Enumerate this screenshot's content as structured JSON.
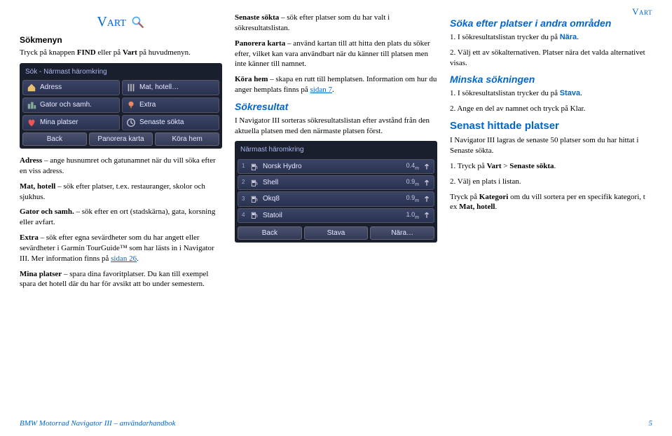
{
  "page_header": "Vart",
  "col1": {
    "heading": "Vart",
    "sokmenyn": "Sökmenyn",
    "intro1": "Tryck på knappen ",
    "intro_find": "FIND",
    "intro2": " eller på ",
    "intro_vart": "Vart",
    "intro3": " på huvudmenyn.",
    "shot1": {
      "title": "Sök - Närmast häromkring",
      "b_adress": "Adress",
      "b_mat": "Mat, hotell…",
      "b_gator": "Gator och samh.",
      "b_extra": "Extra",
      "b_mina": "Mina platser",
      "b_senaste": "Senaste sökta",
      "bb_back": "Back",
      "bb_pan": "Panorera karta",
      "bb_kora": "Köra hem"
    },
    "p_adress_b": "Adress",
    "p_adress": " – ange husnumret och gatunamnet när du vill söka efter en viss adress.",
    "p_mat_b": "Mat, hotell",
    "p_mat": " – sök efter platser, t.ex. restauranger, skolor och sjukhus.",
    "p_gator_b": "Gator och samh.",
    "p_gator": " – sök efter en ort (stadskärna), gata, korsning eller avfart.",
    "p_extra_b": "Extra",
    "p_extra1": " – sök efter egna sevärdheter som du har angett eller sevärdheter i Garmin TourGuide™ som har lästs in i Navigator III. Mer information finns på ",
    "p_extra_link": "sidan 26",
    "p_extra2": ".",
    "p_mina_b": "Mina platser",
    "p_mina": " – spara dina favoritplatser. Du kan till exempel spara det hotell där du har för avsikt att bo under semestern."
  },
  "col2": {
    "p_sen_b": "Senaste sökta",
    "p_sen": " – sök efter platser som du har valt i sökresultatslistan.",
    "p_pan_b": "Panorera karta",
    "p_pan": " – använd kartan till att hitta den plats du söker efter, vilket kan vara användbart när du känner till platsen men inte känner till namnet.",
    "p_kora_b": "Köra hem",
    "p_kora1": " – skapa en rutt till hemplatsen. Information om hur du anger hemplats finns på ",
    "p_kora_link": "sidan 7",
    "p_kora2": ".",
    "sokresultat": "Sökresultat",
    "sokresultat_body": "I Navigator III sorteras sökresultatslistan efter avstånd från den aktuella platsen med den närmaste platsen först.",
    "shot2": {
      "title": "Närmast häromkring",
      "rows": [
        {
          "idx": "1",
          "name": "Norsk Hydro",
          "dist": "0.4"
        },
        {
          "idx": "2",
          "name": "Shell",
          "dist": "0.9"
        },
        {
          "idx": "3",
          "name": "Okq8",
          "dist": "0.9"
        },
        {
          "idx": "4",
          "name": "Statoil",
          "dist": "1.0"
        }
      ],
      "bb_back": "Back",
      "bb_stava": "Stava",
      "bb_nara": "Nära…"
    }
  },
  "col3": {
    "h1": "Söka efter platser i andra områden",
    "l1a": "1.  I sökresultatslistan trycker du på ",
    "l1b": "Nära",
    "l1c": ".",
    "l2a": "2.  Välj ett av sökalternativen. Platser nära det valda alternativet visas.",
    "h2": "Minska sökningen",
    "l3a": "1.  I sökresultatslistan trycker du på ",
    "l3b": "Stava",
    "l3c": ".",
    "l4": "2.  Ange en del av namnet och tryck på Klar.",
    "h3": "Senast hittade platser",
    "h3body": "I Navigator III lagras de senaste 50 platser som du har hittat i Senaste sökta.",
    "l5a": "1.  Tryck på ",
    "l5b": "Vart",
    "l5c": " > ",
    "l5d": "Senaste sökta",
    "l5e": ".",
    "l6": "2.  Välj en plats i listan.",
    "p7a": "Tryck på ",
    "p7b": "Kategori",
    "p7c": " om du vill sortera per en specifik kategori, t ex ",
    "p7d": "Mat, hotell",
    "p7e": "."
  },
  "footer": {
    "left": "BMW Motorrad Navigator III – användarhandbok",
    "page": "5"
  }
}
